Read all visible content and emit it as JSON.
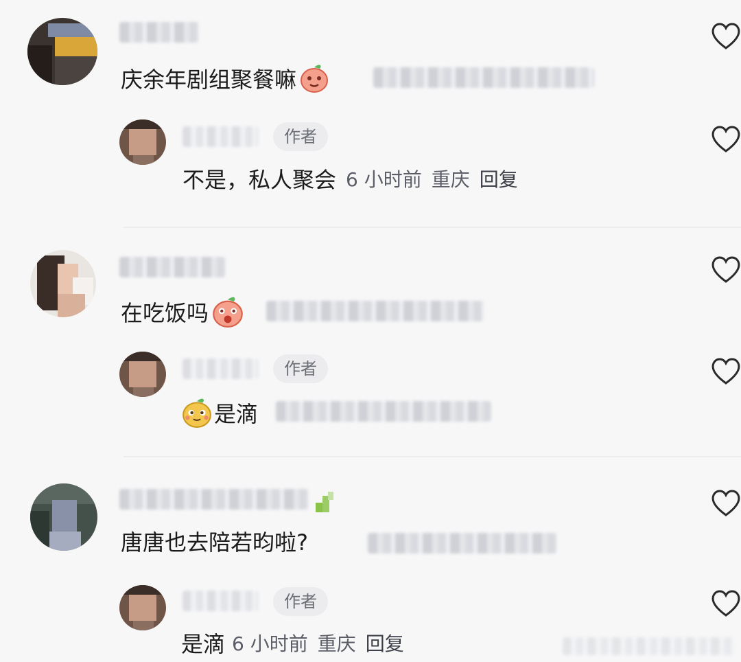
{
  "comments": [
    {
      "text": "庆余年剧组聚餐嘛",
      "reply": {
        "badge": "作者",
        "text": "不是，私人聚会",
        "time": "6 小时前",
        "location": "重庆",
        "reply_label": "回复"
      }
    },
    {
      "text": "在吃饭吗",
      "reply": {
        "badge": "作者",
        "text": "是滴"
      }
    },
    {
      "text": "唐唐也去陪若昀啦?",
      "reply": {
        "badge": "作者",
        "text": "是滴",
        "time": "6 小时前",
        "location": "重庆",
        "reply_label": "回复"
      }
    }
  ],
  "icons": {
    "like": "heart-outline-icon",
    "emoji": "peach-emoji-icon"
  },
  "colors": {
    "background": "#f7f7f8",
    "badge_bg": "#ececef",
    "meta_text": "#5b5e66",
    "emoji_peach": "#f5a08c",
    "emoji_yellow": "#f3c74e"
  }
}
